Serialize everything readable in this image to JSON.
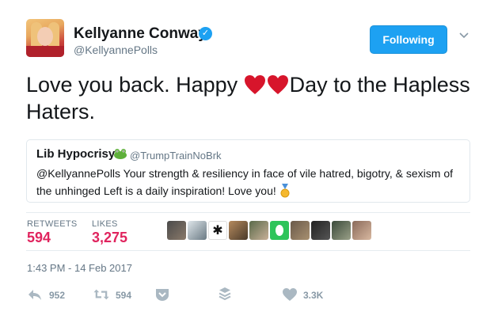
{
  "author": {
    "name": "Kellyanne Conway",
    "handle": "@KellyannePolls"
  },
  "follow_button_label": "Following",
  "tweet": {
    "text_before": "Love you back. Happy ",
    "text_after": "Day to the Hapless Haters."
  },
  "quote": {
    "name": "Lib Hypocrisy",
    "handle": "@TrumpTrainNoBrk",
    "text": "@KellyannePolls Your strength & resiliency in face of vile hatred, bigotry, & sexism of the unhinged Left is a daily inspiration! Love you!"
  },
  "stats": {
    "retweets_label": "RETWEETS",
    "retweets_value": "594",
    "likes_label": "LIKES",
    "likes_value": "3,275"
  },
  "timestamp": "1:43 PM - 14 Feb 2017",
  "actions": {
    "reply_count": "952",
    "retweet_count": "594",
    "like_count": "3.3K"
  },
  "colors": {
    "brand_blue": "#1da1f2",
    "like_red": "#e0245e",
    "muted_text": "#657786",
    "action_gray": "#aab8c2"
  },
  "icons": [
    "verified-badge-icon",
    "chevron-down-icon",
    "heart-emoji-icon",
    "frog-emoji-icon",
    "medal-emoji-icon",
    "reply-icon",
    "retweet-icon",
    "direct-message-icon",
    "add-to-moment-icon",
    "like-icon"
  ]
}
